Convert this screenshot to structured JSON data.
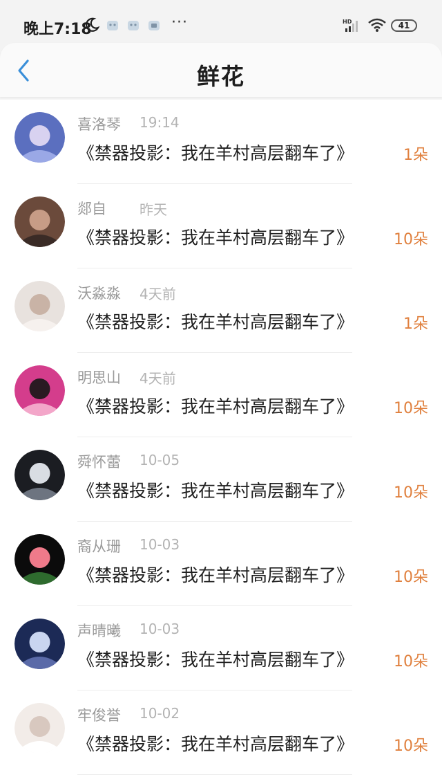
{
  "status_bar": {
    "time": "晚上7:18",
    "more": "···",
    "network": "HD",
    "battery": "41"
  },
  "header": {
    "title": "鲜花"
  },
  "items": [
    {
      "name": "喜洛琴",
      "time": "19:14",
      "book": "《禁器投影：我在羊村高层翻车了》",
      "amount": "1朵",
      "avatar_colors": [
        "#5b6fbf",
        "#d8d2f0",
        "#9aa8e6"
      ]
    },
    {
      "name": "郯自",
      "time": "昨天",
      "book": "《禁器投影：我在羊村高层翻车了》",
      "amount": "10朵",
      "avatar_colors": [
        "#6b4a3b",
        "#c79c86",
        "#3a2b26"
      ]
    },
    {
      "name": "沃淼淼",
      "time": "4天前",
      "book": "《禁器投影：我在羊村高层翻车了》",
      "amount": "1朵",
      "avatar_colors": [
        "#e8e2de",
        "#c9b3a6",
        "#f6f1ee"
      ]
    },
    {
      "name": "明思山",
      "time": "4天前",
      "book": "《禁器投影：我在羊村高层翻车了》",
      "amount": "10朵",
      "avatar_colors": [
        "#d43d8c",
        "#2a1a22",
        "#f3a6c9"
      ]
    },
    {
      "name": "舜怀蕾",
      "time": "10-05",
      "book": "《禁器投影：我在羊村高层翻车了》",
      "amount": "10朵",
      "avatar_colors": [
        "#1b1d22",
        "#d9dde3",
        "#6d7480"
      ]
    },
    {
      "name": "裔从珊",
      "time": "10-03",
      "book": "《禁器投影：我在羊村高层翻车了》",
      "amount": "10朵",
      "avatar_colors": [
        "#0b0b0b",
        "#ef7a8a",
        "#2e6b2e"
      ]
    },
    {
      "name": "声晴曦",
      "time": "10-03",
      "book": "《禁器投影：我在羊村高层翻车了》",
      "amount": "10朵",
      "avatar_colors": [
        "#1c2a56",
        "#c9d5f0",
        "#5a6aa8"
      ]
    },
    {
      "name": "牢俊誉",
      "time": "10-02",
      "book": "《禁器投影：我在羊村高层翻车了》",
      "amount": "10朵",
      "avatar_colors": [
        "#f2ece8",
        "#d8c8bf",
        "#ffffff"
      ]
    }
  ]
}
